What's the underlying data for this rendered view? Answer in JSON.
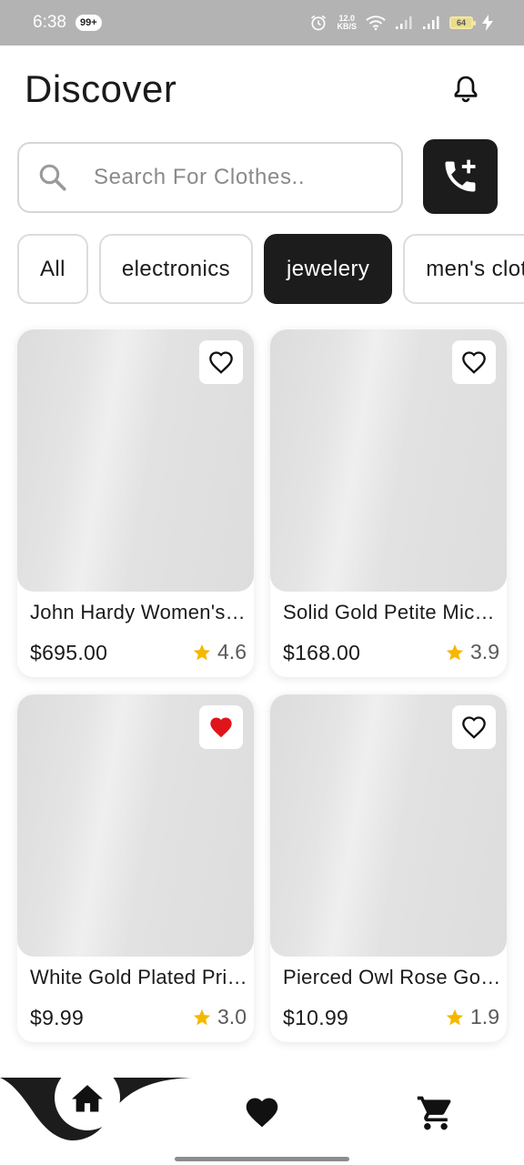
{
  "status_bar": {
    "time": "6:38",
    "notif_badge": "99+",
    "net_speed_value": "12.0",
    "net_speed_unit": "KB/S",
    "battery": "64"
  },
  "header": {
    "title": "Discover"
  },
  "search": {
    "placeholder": "Search For Clothes..",
    "value": ""
  },
  "categories": [
    {
      "label": "All",
      "active": false
    },
    {
      "label": "electronics",
      "active": false
    },
    {
      "label": "jewelery",
      "active": true
    },
    {
      "label": "men's clothing",
      "active": false
    }
  ],
  "products": [
    {
      "title": "John Hardy Women's Legends Naga Gold & Silver Dragon Station Chain Bracelet",
      "price": "$695.00",
      "rating": "4.6",
      "favorited": false
    },
    {
      "title": "Solid Gold Petite Micropave",
      "price": "$168.00",
      "rating": "3.9",
      "favorited": false
    },
    {
      "title": "White Gold Plated Princess",
      "price": "$9.99",
      "rating": "3.0",
      "favorited": true
    },
    {
      "title": "Pierced Owl Rose Gold Plated Stainless Steel Double",
      "price": "$10.99",
      "rating": "1.9",
      "favorited": false
    }
  ],
  "colors": {
    "accent_dark": "#1c1c1c",
    "favorite_red": "#e0141b",
    "star_yellow": "#f5b800",
    "status_bar": "#b3b3b3"
  },
  "icons": {
    "bell": "bell-icon",
    "search": "search-icon",
    "call_add": "add-call-icon",
    "heart": "heart-icon",
    "star": "star-icon",
    "home": "home-icon",
    "cart": "cart-icon"
  }
}
